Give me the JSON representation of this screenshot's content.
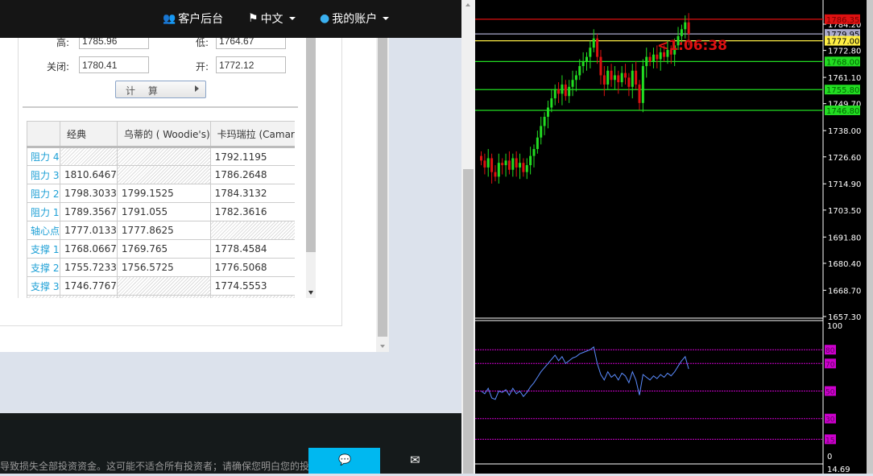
{
  "nav": {
    "client_portal": "客户后台",
    "language": "中文",
    "account": "我的账户"
  },
  "form": {
    "high_label": "高:",
    "high_value": "1785.96",
    "low_label": "低:",
    "low_value": "1764.67",
    "close_label": "关闭:",
    "close_value": "1780.41",
    "open_label": "开:",
    "open_value": "1772.12",
    "calc_button": "计 算"
  },
  "table": {
    "headers": [
      "",
      "经典",
      "乌蒂的 ( Woodie's)",
      "卡玛瑞拉 (Camarilla)"
    ],
    "rows": [
      {
        "label": "阻力 4",
        "cells": [
          "",
          "",
          "1792.1195"
        ]
      },
      {
        "label": "阻力 3",
        "cells": [
          "1810.6467",
          "",
          "1786.2648"
        ]
      },
      {
        "label": "阻力 2",
        "cells": [
          "1798.3033",
          "1799.1525",
          "1784.3132"
        ]
      },
      {
        "label": "阻力 1",
        "cells": [
          "1789.3567",
          "1791.055",
          "1782.3616"
        ]
      },
      {
        "label": "轴心点",
        "cells": [
          "1777.0133",
          "1777.8625",
          ""
        ]
      },
      {
        "label": "支撑 1",
        "cells": [
          "1768.0667",
          "1769.765",
          "1778.4584"
        ]
      },
      {
        "label": "支撑 2",
        "cells": [
          "1755.7233",
          "1756.5725",
          "1776.5068"
        ]
      },
      {
        "label": "支撑 3",
        "cells": [
          "1746.7767",
          "",
          "1774.5553"
        ]
      }
    ]
  },
  "footer": {
    "disclaimer": "导致损失全部投资资金。这可能不适合所有投资者；请确保您明白您的投资"
  },
  "colors": {
    "up": "#22dd22",
    "down": "#dd1111",
    "rsi": "#5b8cff",
    "levels": "#cc00cc",
    "accent": "#00b8f0"
  },
  "chart_data": {
    "type": "candlestick",
    "countdown": "<1:06:38",
    "price_ticks": [
      "1784.20",
      "1772.80",
      "1761.10",
      "1749.70",
      "1738.00",
      "1726.60",
      "1714.90",
      "1703.50",
      "1691.80",
      "1680.40",
      "1668.70",
      "1657.30"
    ],
    "price_range": [
      1657.3,
      1788
    ],
    "levels": [
      {
        "price": 1786.35,
        "label": "1786.35",
        "color": "#dd1111",
        "text": "#700"
      },
      {
        "price": 1779.95,
        "label": "1779.95",
        "color": "#aaaacc",
        "text": "#000"
      },
      {
        "price": 1777.0,
        "label": "1777.00",
        "color": "#ffee44",
        "text": "#000"
      },
      {
        "price": 1768.0,
        "label": "1768.00",
        "color": "#22dd22",
        "text": "#060"
      },
      {
        "price": 1755.8,
        "label": "1755.80",
        "color": "#22dd22",
        "text": "#060"
      },
      {
        "price": 1746.8,
        "label": "1746.80",
        "color": "#22dd22",
        "text": "#060"
      }
    ],
    "closes": [
      1725,
      1722,
      1726,
      1720,
      1718,
      1724,
      1723,
      1725,
      1721,
      1726,
      1722,
      1724,
      1720,
      1723,
      1727,
      1730,
      1735,
      1740,
      1744,
      1748,
      1752,
      1756,
      1754,
      1758,
      1753,
      1757,
      1760,
      1762,
      1766,
      1768,
      1770,
      1774,
      1778,
      1770,
      1762,
      1758,
      1764,
      1760,
      1762,
      1759,
      1763,
      1761,
      1757,
      1764,
      1758,
      1750,
      1766,
      1770,
      1768,
      1771,
      1769,
      1772,
      1770,
      1773,
      1771,
      1775,
      1779,
      1782,
      1785,
      1780
    ],
    "indicator": {
      "range_labels": [
        "100",
        "0"
      ],
      "levels": [
        80,
        70,
        50,
        30,
        15
      ],
      "bottom_value": "14.69",
      "values": [
        50,
        48,
        52,
        45,
        44,
        50,
        49,
        51,
        47,
        52,
        48,
        50,
        46,
        49,
        53,
        56,
        60,
        64,
        67,
        70,
        73,
        76,
        72,
        75,
        70,
        72,
        74,
        75,
        77,
        78,
        79,
        80,
        82,
        70,
        62,
        58,
        64,
        60,
        62,
        58,
        63,
        61,
        56,
        64,
        58,
        47,
        62,
        60,
        58,
        61,
        59,
        62,
        60,
        63,
        61,
        64,
        68,
        72,
        75,
        66
      ]
    }
  }
}
